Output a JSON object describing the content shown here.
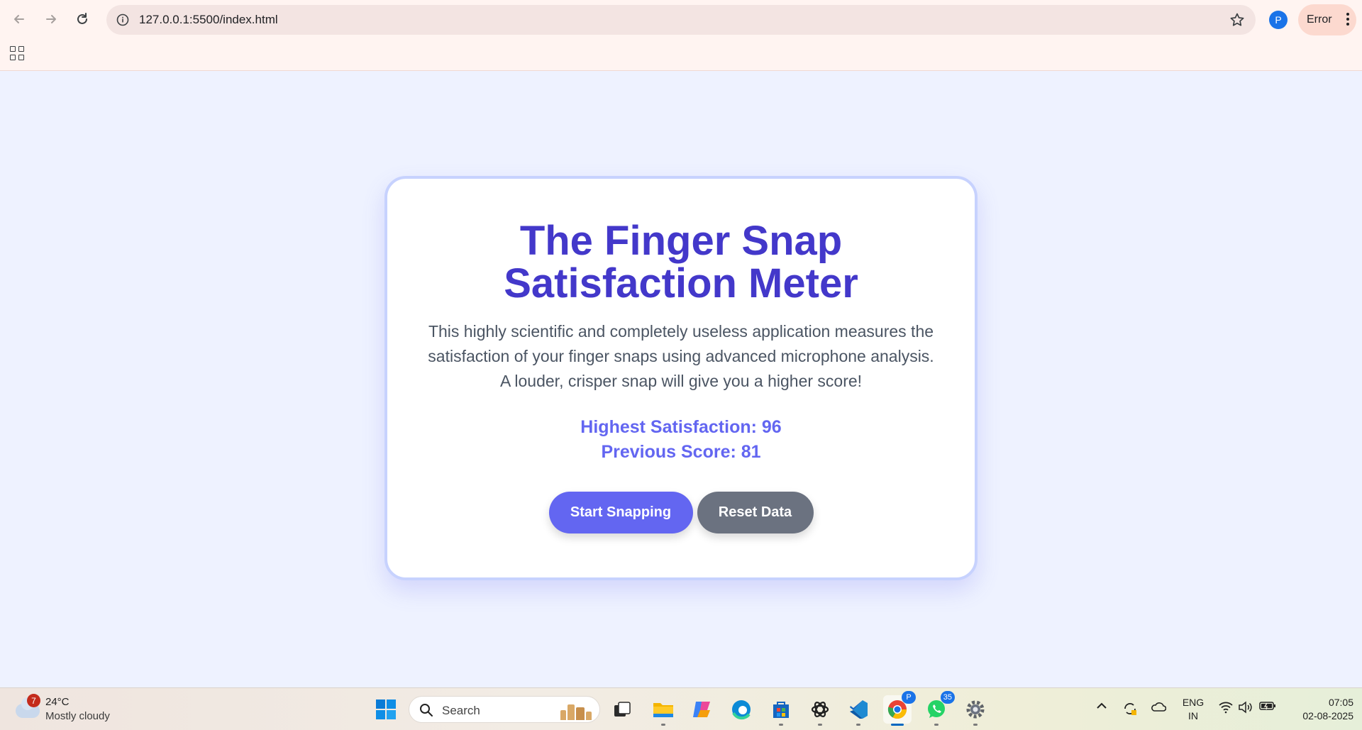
{
  "browser": {
    "url": "127.0.0.1:5500/index.html",
    "profile_initial": "P",
    "error_chip_label": "Error"
  },
  "page": {
    "title": "The Finger Snap Satisfaction Meter",
    "description": "This highly scientific and completely useless application measures the satisfaction of your finger snaps using advanced microphone analysis. A louder, crisper snap will give you a higher score!",
    "highest_satisfaction_text": "Highest Satisfaction: 96",
    "previous_score_text": "Previous Score: 81",
    "start_button_label": "Start Snapping",
    "reset_button_label": "Reset Data",
    "colors": {
      "title": "#4338ca",
      "score": "#6366f1",
      "start_button": "#6366f1",
      "reset_button": "#6b7280",
      "card_border": "#c7d2fe",
      "background": "#eef2ff"
    }
  },
  "taskbar": {
    "weather": {
      "badge": "7",
      "temperature": "24°C",
      "condition": "Mostly cloudy"
    },
    "search_label": "Search",
    "apps": [
      {
        "name": "start-icon"
      },
      {
        "name": "task-view-icon"
      },
      {
        "name": "file-explorer-icon"
      },
      {
        "name": "copilot-icon"
      },
      {
        "name": "edge-icon"
      },
      {
        "name": "microsoft-store-icon"
      },
      {
        "name": "chatgpt-icon"
      },
      {
        "name": "vscode-icon"
      },
      {
        "name": "chrome-icon",
        "badge": "P"
      },
      {
        "name": "whatsapp-icon",
        "badge": "35"
      },
      {
        "name": "settings-icon"
      }
    ],
    "tray": {
      "language_line1": "ENG",
      "language_line2": "IN",
      "time": "07:05",
      "date": "02-08-2025"
    }
  }
}
